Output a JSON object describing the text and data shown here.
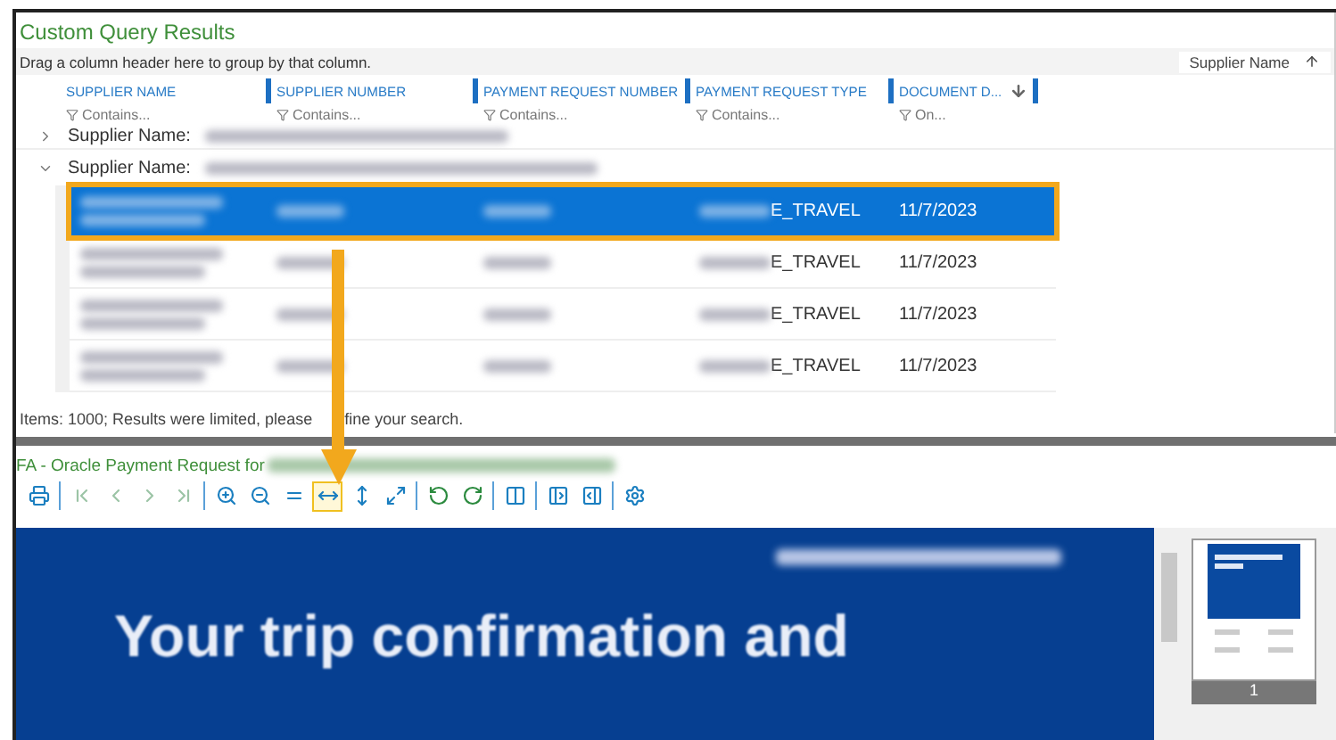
{
  "results_panel": {
    "title": "Custom Query Results",
    "group_bar": {
      "hint": "Drag a column header here to group by that column.",
      "groups": [
        {
          "label": "Supplier Name",
          "sorted": true
        }
      ]
    },
    "columns": [
      {
        "label": "SUPPLIER NAME",
        "filter": "Contains...",
        "sorted": false
      },
      {
        "label": "SUPPLIER NUMBER",
        "filter": "Contains...",
        "sorted": false
      },
      {
        "label": "PAYMENT REQUEST NUMBER",
        "filter": "Contains...",
        "sorted": false
      },
      {
        "label": "PAYMENT REQUEST TYPE",
        "filter": "Contains...",
        "sorted": false
      },
      {
        "label": "DOCUMENT D...",
        "filter": "On...",
        "sorted": true
      }
    ],
    "group_rows": [
      {
        "label": "Supplier Name:",
        "expanded": false
      },
      {
        "label": "Supplier Name:",
        "expanded": true
      }
    ],
    "rows": [
      {
        "selected": true,
        "highlighted": true,
        "cells": [
          {
            "kind": "blurred_two_lines"
          },
          {
            "kind": "blurred"
          },
          {
            "kind": "blurred"
          },
          {
            "kind": "partly_blurred",
            "text": "E_TRAVEL"
          },
          {
            "kind": "text",
            "text": "11/7/2023"
          }
        ]
      },
      {
        "selected": false,
        "highlighted": false,
        "cells": [
          {
            "kind": "blurred_two_lines"
          },
          {
            "kind": "blurred"
          },
          {
            "kind": "blurred"
          },
          {
            "kind": "partly_blurred",
            "text": "E_TRAVEL"
          },
          {
            "kind": "text",
            "text": "11/7/2023"
          }
        ]
      },
      {
        "selected": false,
        "highlighted": false,
        "cells": [
          {
            "kind": "blurred_two_lines"
          },
          {
            "kind": "blurred"
          },
          {
            "kind": "blurred"
          },
          {
            "kind": "partly_blurred",
            "text": "E_TRAVEL"
          },
          {
            "kind": "text",
            "text": "11/7/2023"
          }
        ]
      },
      {
        "selected": false,
        "highlighted": false,
        "cells": [
          {
            "kind": "blurred_two_lines"
          },
          {
            "kind": "blurred"
          },
          {
            "kind": "blurred"
          },
          {
            "kind": "partly_blurred",
            "text": "E_TRAVEL"
          },
          {
            "kind": "text",
            "text": "11/7/2023"
          }
        ]
      }
    ],
    "status": [
      "Items: 1000; Results were limited, please",
      "fine your search."
    ]
  },
  "callout_arrow": true,
  "viewer": {
    "title": "FA - Oracle Payment Request for",
    "title_blurred": true,
    "toolbar": [
      [
        {
          "kind": "print",
          "disabled": false,
          "selected": false
        }
      ],
      [
        {
          "kind": "first",
          "disabled": true,
          "selected": false
        },
        {
          "kind": "previous",
          "disabled": true,
          "selected": false
        },
        {
          "kind": "next",
          "disabled": true,
          "selected": false
        },
        {
          "kind": "last",
          "disabled": true,
          "selected": false
        }
      ],
      [
        {
          "kind": "zoom_in",
          "disabled": false,
          "selected": false
        },
        {
          "kind": "zoom_out",
          "disabled": false,
          "selected": false
        },
        {
          "kind": "fit_page",
          "disabled": false,
          "selected": false
        },
        {
          "kind": "fit_width",
          "disabled": false,
          "selected": true
        },
        {
          "kind": "fit_height",
          "disabled": false,
          "selected": false
        },
        {
          "kind": "full",
          "disabled": false,
          "selected": false
        }
      ],
      [
        {
          "kind": "rotate_left",
          "disabled": false,
          "selected": false
        },
        {
          "kind": "rotate_right",
          "disabled": false,
          "selected": false
        }
      ],
      [
        {
          "kind": "two_page",
          "disabled": false,
          "selected": false
        }
      ],
      [
        {
          "kind": "page_left",
          "disabled": false,
          "selected": false
        },
        {
          "kind": "page_right",
          "disabled": false,
          "selected": false
        }
      ],
      [
        {
          "kind": "settings",
          "disabled": false,
          "selected": false
        }
      ]
    ],
    "document": {
      "heading": "Your trip confirmation and",
      "issued_blurred": true
    },
    "thumbnails": [
      {
        "page": "1",
        "selected": true
      }
    ]
  }
}
